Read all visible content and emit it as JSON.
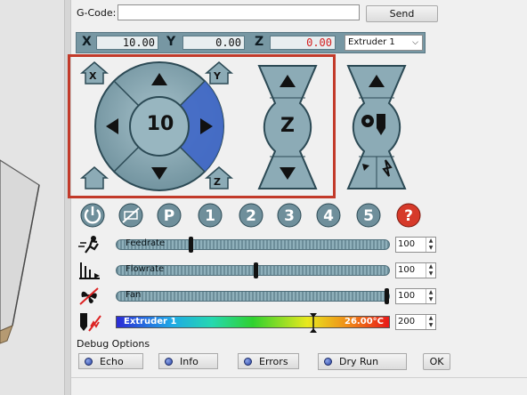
{
  "gcode": {
    "label": "G-Code:",
    "value": "",
    "send_label": "Send"
  },
  "coords": {
    "x_label": "X",
    "x_value": "10.00",
    "y_label": "Y",
    "y_value": "0.00",
    "z_label": "Z",
    "z_value": "0.00",
    "extruder_selected": "Extruder 1"
  },
  "jog": {
    "step_value": "10",
    "home_x_label": "X",
    "home_y_label": "Y",
    "home_z_label": "Z",
    "z_label": "Z"
  },
  "icons": [
    "power-icon",
    "no-cooling-icon",
    "park-icon",
    "macro-1",
    "macro-2",
    "macro-3",
    "macro-4",
    "macro-5",
    "help-icon"
  ],
  "macros": [
    "P",
    "1",
    "2",
    "3",
    "4",
    "5",
    "?"
  ],
  "sliders": {
    "feedrate": {
      "label": "Feedrate",
      "value": "100",
      "level": 0.27
    },
    "flowrate": {
      "label": "Flowrate",
      "value": "100",
      "level": 0.51
    },
    "fan": {
      "label": "Fan",
      "value": "100",
      "level": 1.0
    }
  },
  "extruder": {
    "name": "Extruder 1",
    "temperature": "26.00°C",
    "target": "200"
  },
  "debug": {
    "title": "Debug Options",
    "echo": "Echo",
    "info": "Info",
    "errors": "Errors",
    "dry_run": "Dry Run",
    "ok": "OK"
  },
  "colors": {
    "frame": "#c23a2a",
    "panel": "#7797a3",
    "active_pad": "#3f67c8",
    "macro_blue": "#6f8f9b",
    "help_red": "#d63a2a"
  }
}
